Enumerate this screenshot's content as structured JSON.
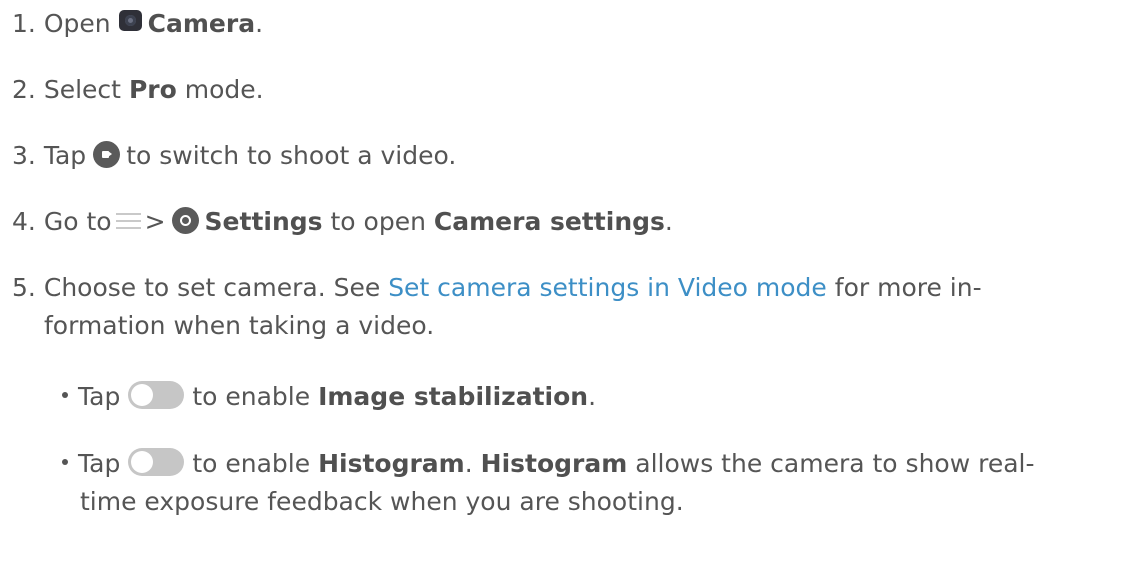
{
  "steps": [
    {
      "number": "1.",
      "text_before": "Open",
      "icon": "camera-app-icon",
      "bold": "Camera",
      "text_after": "."
    },
    {
      "number": "2.",
      "text_before": "Select",
      "bold": "Pro",
      "text_after": "mode."
    },
    {
      "number": "3.",
      "text_before": "Tap",
      "icon": "video-record-icon",
      "text_after": "to switch to shoot a video."
    },
    {
      "number": "4.",
      "text_before": "Go to",
      "icon_menu": "menu-icon",
      "separator": ">",
      "icon_settings": "settings-icon",
      "bold": "Settings",
      "text_mid": "to open",
      "bold2": "Camera settings",
      "text_after": "."
    },
    {
      "number": "5.",
      "text_before": "Choose to set camera. See",
      "link": "Set camera settings in Video mode",
      "text_after": "for more in-",
      "continuation": "formation when taking a video."
    }
  ],
  "bullets": [
    {
      "text_before": "Tap",
      "icon": "toggle-switch-icon",
      "text_mid": "to enable",
      "bold": "Image stabilization",
      "text_after": "."
    },
    {
      "text_before": "Tap",
      "icon": "toggle-switch-icon",
      "text_mid": "to enable",
      "bold": "Histogram",
      "text_after": ".",
      "bold2": "Histogram",
      "text_after2": "allows the camera to show real-",
      "continuation": "time exposure feedback when you are shooting."
    }
  ],
  "colors": {
    "text": "#555555",
    "link": "#3d8fc6",
    "toggle": "#c6c6c6"
  }
}
